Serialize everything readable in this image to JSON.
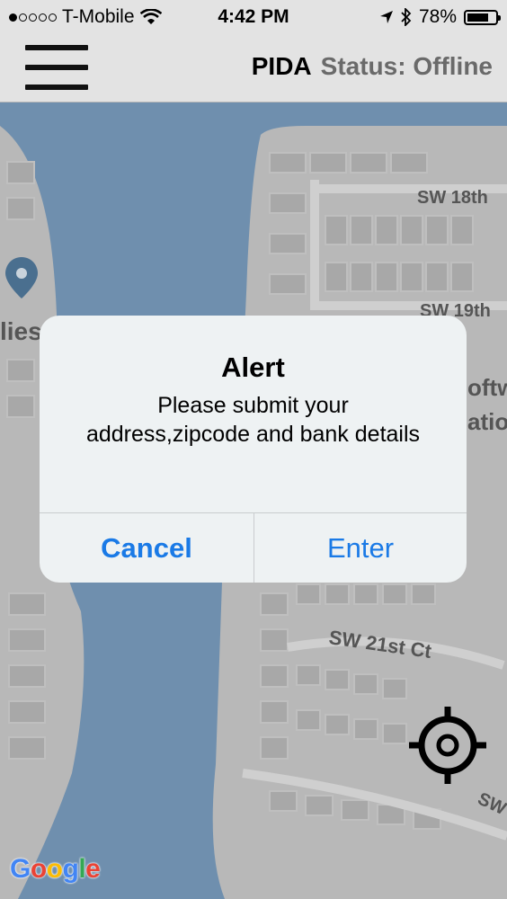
{
  "status_bar": {
    "carrier": "T-Mobile",
    "signal_bars_filled": 1,
    "signal_bars_total": 5,
    "time": "4:42 PM",
    "battery_percent_label": "78%",
    "battery_level": 0.78,
    "icons": [
      "wifi-icon",
      "location-arrow-icon",
      "bluetooth-icon",
      "battery-icon"
    ]
  },
  "nav": {
    "app_name": "PIDA",
    "status_text": "Status: Offline",
    "menu_icon": "hamburger-menu-icon"
  },
  "map": {
    "labels": {
      "sw18": "SW 18th",
      "sw19": "SW 19th",
      "sw21": "SW 21st Ct",
      "left_fragment": "lies",
      "right_fragment_1": "oftw",
      "right_fragment_2": "atio",
      "bottom_fragment": "SW"
    },
    "attribution": [
      "G",
      "o",
      "o",
      "g",
      "l",
      "e"
    ],
    "attribution_colors": [
      "#4285f4",
      "#ea4335",
      "#fbbc05",
      "#4285f4",
      "#34a853",
      "#ea4335"
    ],
    "colors": {
      "water": "#6f8fae",
      "land": "#b9b9b9",
      "building": "#a9a9a9"
    }
  },
  "alert": {
    "title": "Alert",
    "message": "Please submit your address,zipcode and bank details",
    "cancel_label": "Cancel",
    "enter_label": "Enter",
    "button_color": "#1a7ae6"
  },
  "controls": {
    "locate_icon": "my-location-crosshair-icon",
    "pin_icon": "map-pin-icon"
  }
}
